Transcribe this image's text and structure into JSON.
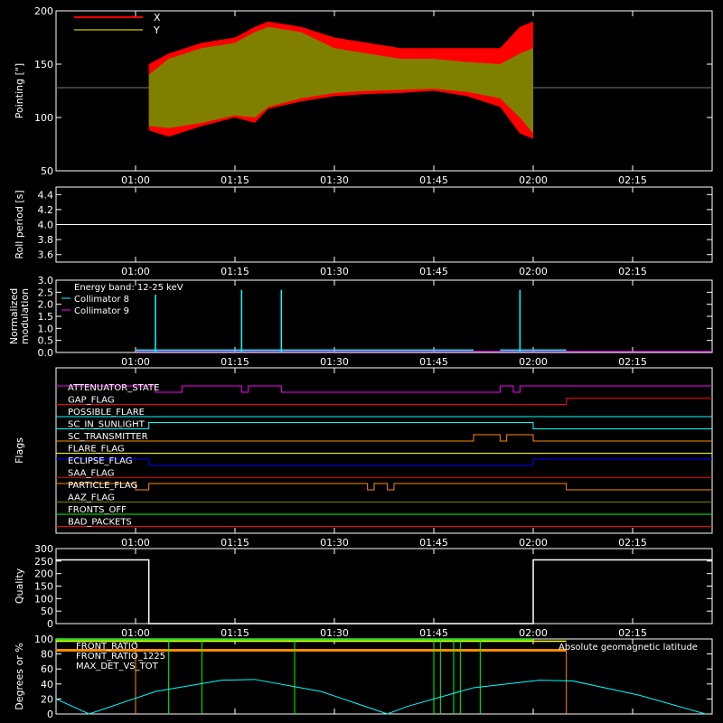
{
  "colors": {
    "background": "#000000",
    "axes": "#ffffff",
    "x_series": "#ff0000",
    "y_series": "#808000",
    "cyan": "#00ffff",
    "magenta": "#ff00ff",
    "orange": "#ff8c00",
    "yellow": "#ffff00",
    "green": "#00ff00",
    "blue": "#0000ff",
    "red": "#ff0000",
    "dark_red": "#cc0000",
    "olive": "#808000"
  },
  "time_axis": {
    "tick_labels": [
      "01:00",
      "01:15",
      "01:30",
      "01:45",
      "02:00",
      "02:15"
    ],
    "start": "00:48",
    "end": "02:27"
  },
  "chart_data": [
    {
      "id": "pointing",
      "type": "area",
      "ylabel": "Pointing [\"]",
      "ylim": [
        50,
        200
      ],
      "yticks": [
        "50",
        "100",
        "150",
        "200"
      ],
      "legend": [
        "X",
        "Y"
      ],
      "reference_line": 128,
      "data_window": [
        "01:02",
        "02:00"
      ],
      "x_envelope": {
        "x": [
          "01:02",
          "01:05",
          "01:10",
          "01:15",
          "01:18",
          "01:20",
          "01:25",
          "01:30",
          "01:35",
          "01:40",
          "01:45",
          "01:50",
          "01:55",
          "01:58",
          "02:00"
        ],
        "upper": [
          150,
          160,
          170,
          175,
          185,
          190,
          185,
          175,
          170,
          165,
          165,
          165,
          165,
          185,
          190
        ],
        "lower": [
          88,
          82,
          92,
          100,
          95,
          108,
          115,
          120,
          122,
          123,
          125,
          120,
          110,
          85,
          80
        ]
      },
      "y_envelope": {
        "x": [
          "01:02",
          "01:05",
          "01:10",
          "01:15",
          "01:18",
          "01:20",
          "01:25",
          "01:30",
          "01:35",
          "01:40",
          "01:45",
          "01:50",
          "01:55",
          "01:58",
          "02:00"
        ],
        "upper": [
          140,
          155,
          165,
          170,
          180,
          185,
          180,
          165,
          160,
          155,
          155,
          152,
          150,
          160,
          165
        ],
        "lower": [
          92,
          90,
          95,
          102,
          100,
          110,
          118,
          123,
          125,
          126,
          127,
          124,
          118,
          100,
          85
        ]
      }
    },
    {
      "id": "roll",
      "type": "line",
      "ylabel": "Roll period [s]",
      "ylim": [
        3.5,
        4.5
      ],
      "yticks": [
        "3.6",
        "3.8",
        "4.0",
        "4.2",
        "4.4"
      ],
      "value": 4.0
    },
    {
      "id": "modulation",
      "type": "line",
      "ylabel": [
        "Normalized",
        "modulation"
      ],
      "ylim": [
        0,
        3
      ],
      "yticks": [
        "0.0",
        "0.5",
        "1.0",
        "1.5",
        "2.0",
        "2.5",
        "3.0"
      ],
      "legend": [
        "Energy band: 12-25 keV",
        "Collimator 8",
        "Collimator 9"
      ],
      "collimator8_segments": [
        [
          "01:00",
          "01:51"
        ],
        [
          "01:55",
          "02:05"
        ]
      ],
      "spikes": [
        {
          "t": "01:03",
          "v": 2.4
        },
        {
          "t": "01:16",
          "v": 2.6
        },
        {
          "t": "01:22",
          "v": 2.6
        },
        {
          "t": "01:58",
          "v": 2.6
        }
      ]
    },
    {
      "id": "flags",
      "type": "table",
      "ylabel": "Flags",
      "rows": [
        {
          "label": "ATTENUATOR_STATE",
          "color": "#ff00ff",
          "transitions": [
            [
              "00:48",
              1
            ],
            [
              "01:03",
              0
            ],
            [
              "01:07",
              1
            ],
            [
              "01:16",
              0
            ],
            [
              "01:17",
              1
            ],
            [
              "01:22",
              0
            ],
            [
              "01:55",
              1
            ],
            [
              "01:57",
              0
            ],
            [
              "01:58",
              1
            ],
            [
              "02:27",
              1
            ]
          ]
        },
        {
          "label": "GAP_FLAG",
          "color": "#ff0000",
          "transitions": [
            [
              "00:48",
              0
            ],
            [
              "02:05",
              1
            ],
            [
              "02:27",
              1
            ]
          ]
        },
        {
          "label": "POSSIBLE_FLARE",
          "color": "#00ffff",
          "transitions": [
            [
              "00:48",
              0
            ],
            [
              "02:27",
              0
            ]
          ]
        },
        {
          "label": "SC_IN_SUNLIGHT",
          "color": "#00ffff",
          "transitions": [
            [
              "00:48",
              0
            ],
            [
              "01:02",
              1
            ],
            [
              "02:00",
              0
            ],
            [
              "02:27",
              0
            ]
          ]
        },
        {
          "label": "SC_TRANSMITTER",
          "color": "#ff8c00",
          "transitions": [
            [
              "00:48",
              0
            ],
            [
              "01:51",
              1
            ],
            [
              "01:55",
              0
            ],
            [
              "01:56",
              1
            ],
            [
              "02:00",
              0
            ],
            [
              "02:27",
              0
            ]
          ]
        },
        {
          "label": "FLARE_FLAG",
          "color": "#ffff00",
          "transitions": [
            [
              "00:48",
              0
            ],
            [
              "02:27",
              0
            ]
          ]
        },
        {
          "label": "ECLIPSE_FLAG",
          "color": "#0000ff",
          "transitions": [
            [
              "00:48",
              1
            ],
            [
              "01:02",
              0
            ],
            [
              "02:00",
              1
            ],
            [
              "02:27",
              1
            ]
          ]
        },
        {
          "label": "SAA_FLAG",
          "color": "#cc0000",
          "transitions": [
            [
              "00:48",
              0
            ],
            [
              "02:27",
              0
            ]
          ]
        },
        {
          "label": "PARTICLE_FLAG",
          "color": "#ff8c00",
          "transitions": [
            [
              "00:48",
              1
            ],
            [
              "01:00",
              0
            ],
            [
              "01:02",
              1
            ],
            [
              "01:35",
              0
            ],
            [
              "01:36",
              1
            ],
            [
              "01:38",
              0
            ],
            [
              "01:39",
              1
            ],
            [
              "02:05",
              0
            ],
            [
              "02:27",
              0
            ]
          ]
        },
        {
          "label": "AAZ_FLAG",
          "color": "#808000",
          "transitions": [
            [
              "00:48",
              0
            ],
            [
              "02:27",
              0
            ]
          ]
        },
        {
          "label": "FRONTS_OFF",
          "color": "#00ff00",
          "transitions": [
            [
              "00:48",
              0
            ],
            [
              "02:27",
              0
            ]
          ]
        },
        {
          "label": "BAD_PACKETS",
          "color": "#ff0000",
          "transitions": [
            [
              "00:48",
              0
            ],
            [
              "02:27",
              0
            ]
          ]
        }
      ]
    },
    {
      "id": "quality",
      "type": "line",
      "ylabel": "Quality",
      "ylim": [
        0,
        300
      ],
      "yticks": [
        "0",
        "50",
        "100",
        "150",
        "200",
        "250",
        "300"
      ],
      "points": [
        [
          "00:48",
          255
        ],
        [
          "01:02",
          255
        ],
        [
          "01:02",
          0
        ],
        [
          "02:00",
          0
        ],
        [
          "02:00",
          255
        ],
        [
          "02:27",
          255
        ]
      ]
    },
    {
      "id": "ratios",
      "type": "line",
      "ylabel": "Degrees or %",
      "ylim": [
        0,
        100
      ],
      "yticks": [
        "0",
        "20",
        "40",
        "60",
        "80",
        "100"
      ],
      "legend": [
        "FRONT_RATIO",
        "FRONT_RATIO_1225",
        "MAX_DET_VS_TOT",
        "Absolute geomagnetic latitude"
      ],
      "front_ratio_level": 97,
      "front_ratio_1225_level": 99,
      "max_det_level": 85,
      "green_drops": [
        "01:05",
        "01:10",
        "01:24",
        "01:45",
        "01:46",
        "01:48",
        "01:49",
        "01:52"
      ],
      "latitude": {
        "x": [
          "00:48",
          "00:53",
          "01:03",
          "01:13",
          "01:18",
          "01:28",
          "01:38",
          "01:41",
          "01:51",
          "02:01",
          "02:06",
          "02:16",
          "02:26"
        ],
        "y": [
          20,
          0,
          30,
          45,
          46,
          30,
          0,
          10,
          35,
          45,
          44,
          25,
          0
        ]
      }
    }
  ]
}
